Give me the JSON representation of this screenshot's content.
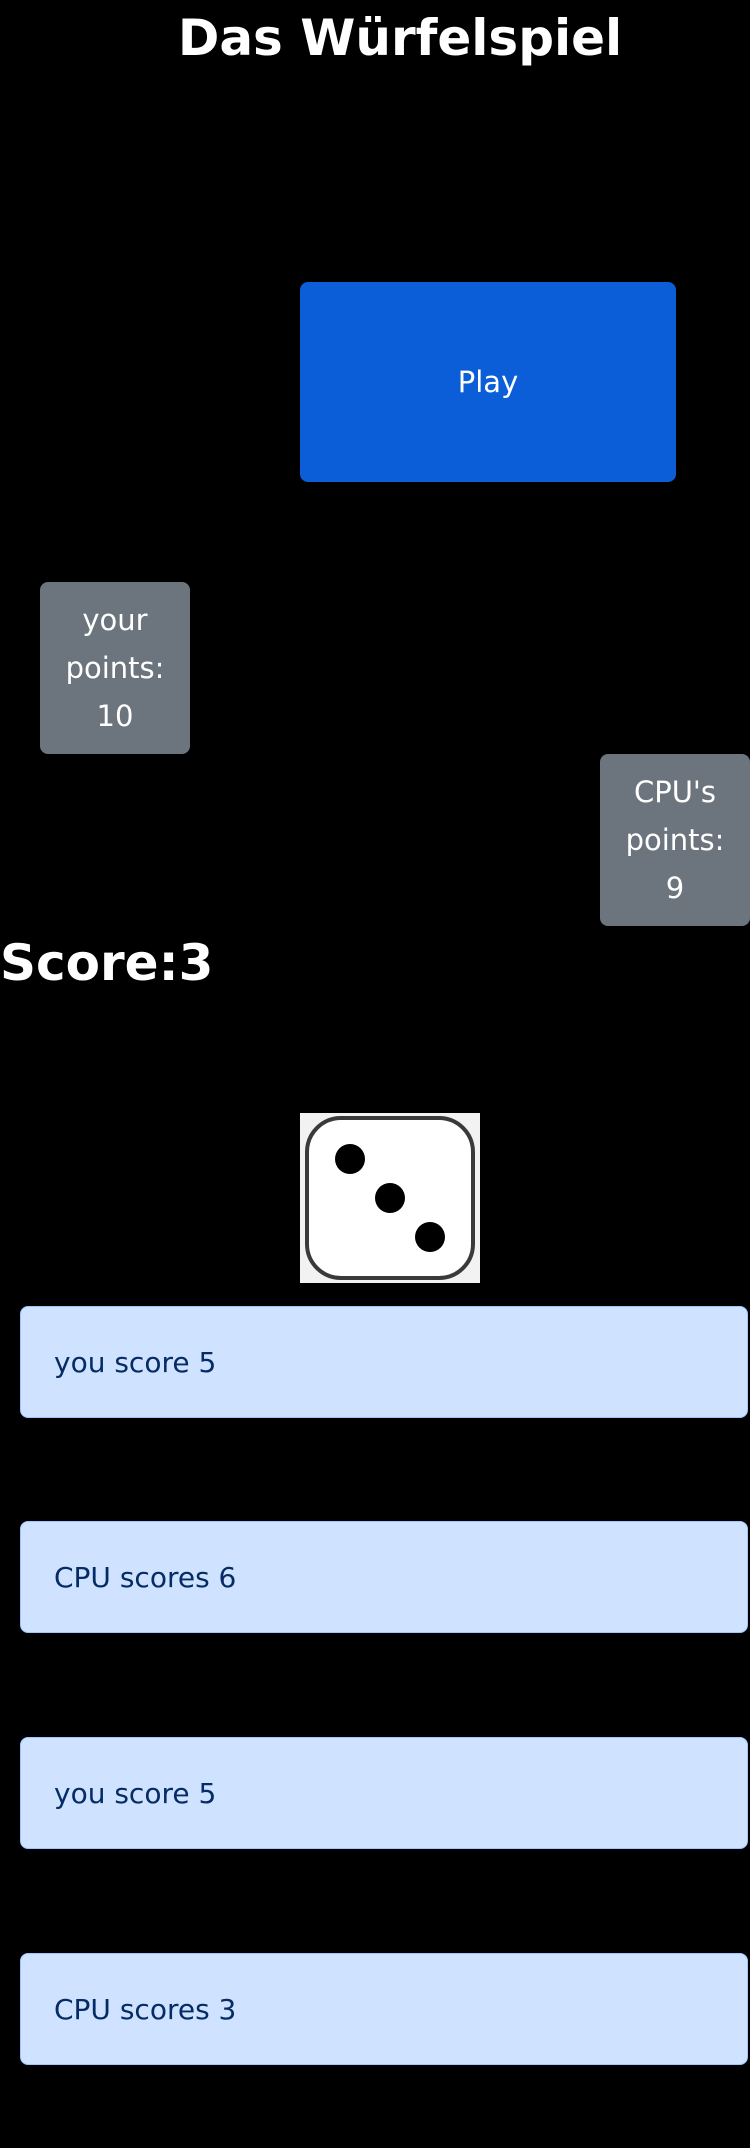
{
  "header": {
    "title": "Das Würfelspiel"
  },
  "controls": {
    "play_label": "Play"
  },
  "player": {
    "label_line1": "your",
    "label_line2": "points:",
    "points": "10"
  },
  "cpu": {
    "label_line1": "CPU's",
    "label_line2": "points:",
    "points": "9"
  },
  "score": {
    "text": "Score:3"
  },
  "die": {
    "face": 3,
    "icon": "die-face-3-icon"
  },
  "log": [
    "you score 5",
    "CPU scores 6",
    "you score 5",
    "CPU scores 3"
  ],
  "colors": {
    "background": "#000000",
    "play_button": "#0b5ed7",
    "points_box": "#6c757d",
    "log_bg": "#cfe2ff",
    "log_border": "#9ec5fe",
    "log_text": "#052c65"
  }
}
